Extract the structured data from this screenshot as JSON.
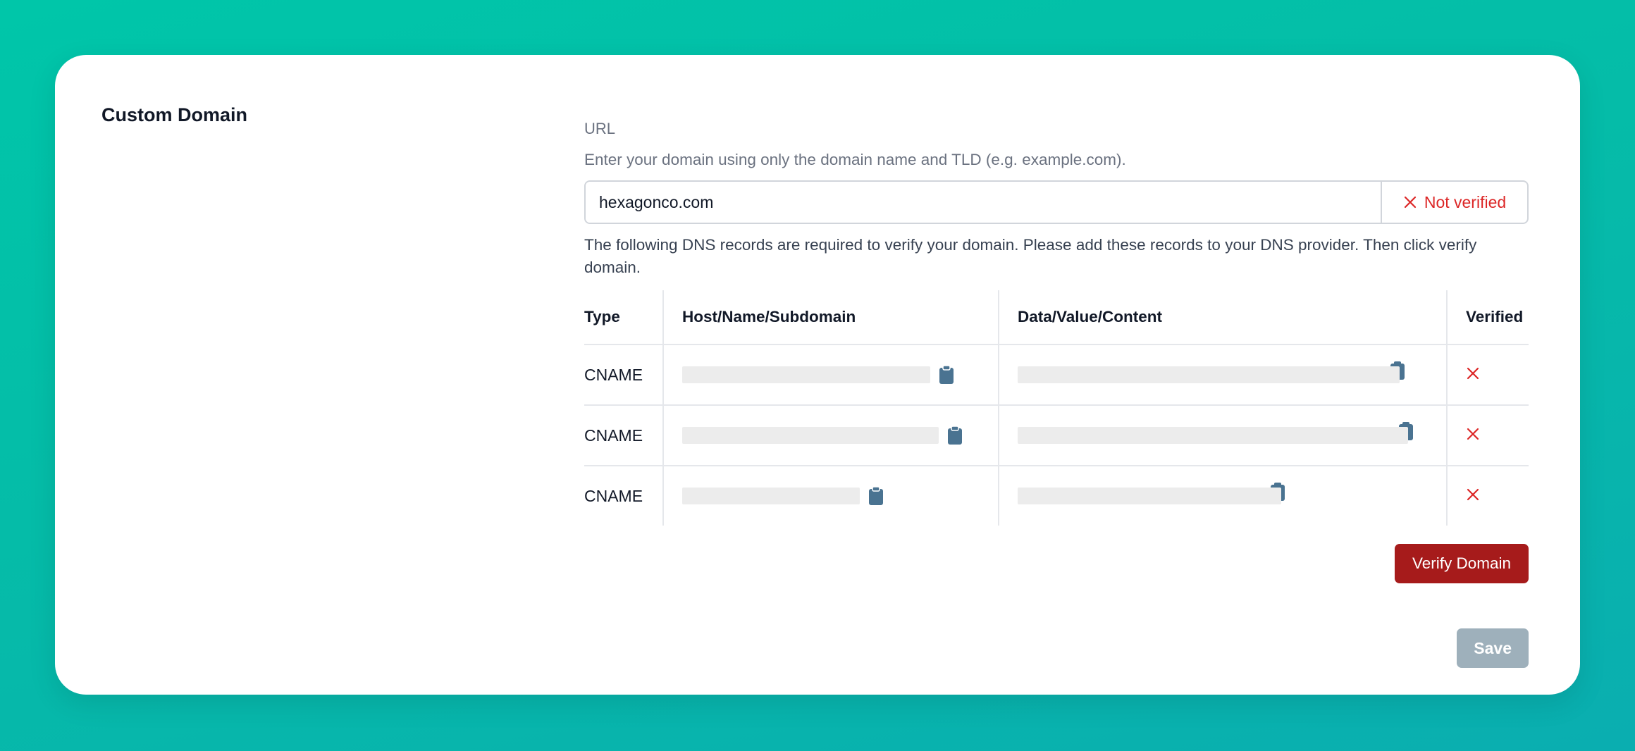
{
  "section": {
    "title": "Custom Domain"
  },
  "url_field": {
    "label": "URL",
    "helper": "Enter your domain using only the domain name and TLD (e.g. example.com).",
    "value": "hexagonco.com",
    "status": "Not verified",
    "status_icon": "x-icon",
    "status_color": "#dc2626"
  },
  "dns_info": "The following DNS records are required to verify your domain. Please add these records to your DNS provider. Then click verify domain.",
  "table": {
    "headers": [
      "Type",
      "Host/Name/Subdomain",
      "Data/Value/Content",
      "Verified"
    ],
    "rows": [
      {
        "type": "CNAME",
        "verified_icon": "x-icon"
      },
      {
        "type": "CNAME",
        "verified_icon": "x-icon"
      },
      {
        "type": "CNAME",
        "verified_icon": "x-icon"
      }
    ],
    "copy_icon": "clipboard-icon",
    "copy_icon_color": "#4a7391"
  },
  "buttons": {
    "verify_label": "Verify Domain",
    "verify_color": "#a61b1b",
    "save_label": "Save",
    "save_color": "#9eb0bb"
  }
}
